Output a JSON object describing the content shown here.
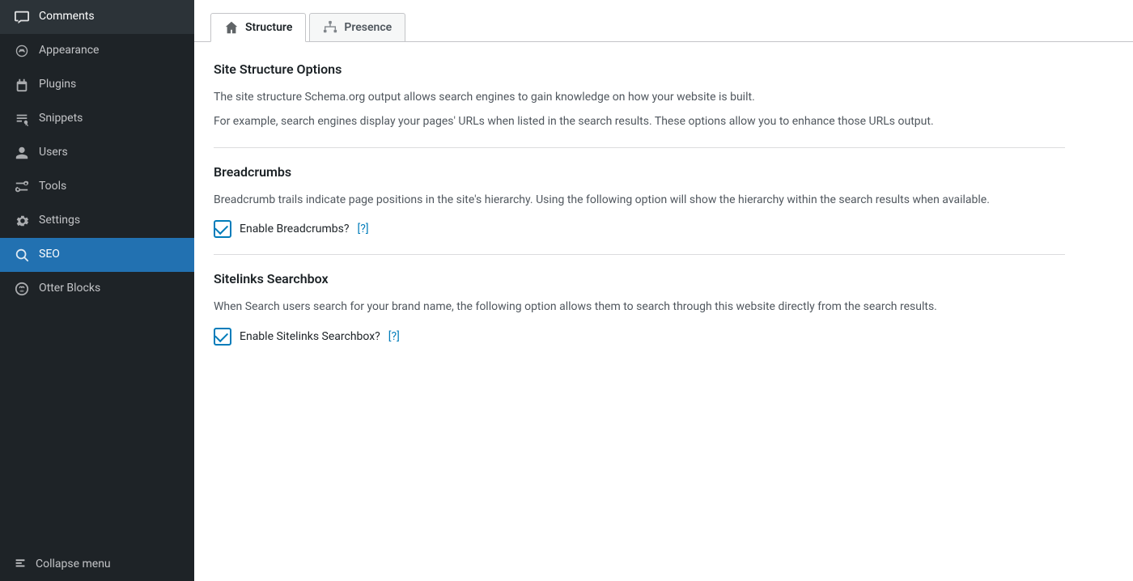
{
  "sidebar": {
    "items": [
      {
        "id": "comments",
        "label": "Comments",
        "icon": "comments"
      },
      {
        "id": "appearance",
        "label": "Appearance",
        "icon": "appearance"
      },
      {
        "id": "plugins",
        "label": "Plugins",
        "icon": "plugins"
      },
      {
        "id": "snippets",
        "label": "Snippets",
        "icon": "snippets"
      },
      {
        "id": "users",
        "label": "Users",
        "icon": "users"
      },
      {
        "id": "tools",
        "label": "Tools",
        "icon": "tools"
      },
      {
        "id": "settings",
        "label": "Settings",
        "icon": "settings"
      },
      {
        "id": "seo",
        "label": "SEO",
        "icon": "seo",
        "active": true
      },
      {
        "id": "otter-blocks",
        "label": "Otter Blocks",
        "icon": "otter"
      }
    ],
    "collapse_label": "Collapse menu"
  },
  "tabs": [
    {
      "id": "structure",
      "label": "Structure",
      "active": true
    },
    {
      "id": "presence",
      "label": "Presence",
      "active": false
    }
  ],
  "page": {
    "structure_title": "Site Structure Options",
    "structure_desc1": "The site structure Schema.org output allows search engines to gain knowledge on how your website is built.",
    "structure_desc2": "For example, search engines display your pages' URLs when listed in the search results. These options allow you to enhance those URLs output.",
    "breadcrumbs_title": "Breadcrumbs",
    "breadcrumbs_desc": "Breadcrumb trails indicate page positions in the site's hierarchy. Using the following option will show the hierarchy within the search results when available.",
    "breadcrumbs_checkbox_label": "Enable Breadcrumbs?",
    "breadcrumbs_help": "[?]",
    "sitelinks_title": "Sitelinks Searchbox",
    "sitelinks_desc": "When Search users search for your brand name, the following option allows them to search through this website directly from the search results.",
    "sitelinks_checkbox_label": "Enable Sitelinks Searchbox?",
    "sitelinks_help": "[?]"
  }
}
